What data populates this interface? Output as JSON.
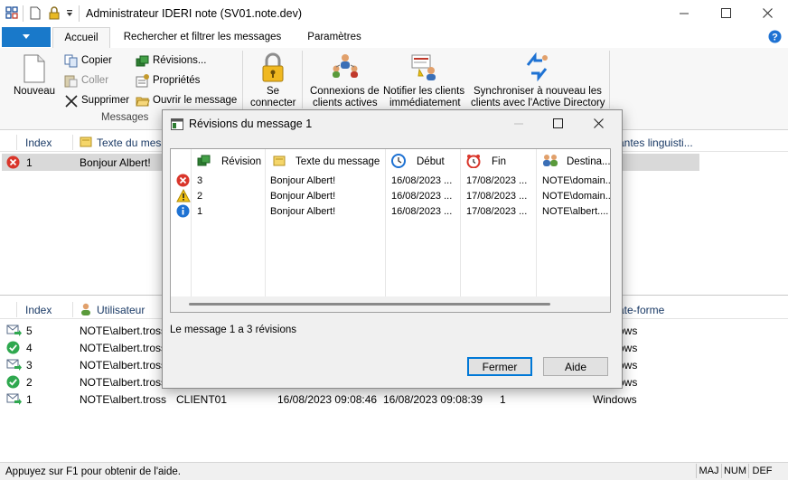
{
  "window": {
    "title": "Administrateur IDERI note (SV01.note.dev)"
  },
  "ribbon": {
    "tabs": [
      {
        "label": "Accueil",
        "active": true
      },
      {
        "label": "Rechercher et filtrer les messages",
        "active": false
      },
      {
        "label": "Paramètres",
        "active": false
      }
    ],
    "new_label": "Nouveau",
    "copy_label": "Copier",
    "paste_label": "Coller",
    "delete_label": "Supprimer",
    "revisions_label": "Révisions...",
    "properties_label": "Propriétés",
    "open_label": "Ouvrir le message",
    "group_messages": "Messages",
    "connect_line1": "Se",
    "connect_line2": "connecter",
    "client_conn_line1": "Connexions de",
    "client_conn_line2": "clients actives",
    "notify_line1": "Notifier les clients",
    "notify_line2": "immédiatement",
    "sync_line1": "Synchroniser à nouveau les",
    "sync_line2": "clients avec l'Active Directory"
  },
  "messages_list": {
    "headers": {
      "index": "Index",
      "text": "Texte du mess",
      "variants": "antes linguisti..."
    },
    "rows": [
      {
        "index": "1",
        "text": "Bonjour Albert!"
      }
    ]
  },
  "receipts_list": {
    "headers": {
      "index": "Index",
      "user": "Utilisateur",
      "platform": "ate-forme"
    },
    "rows": [
      {
        "index": "5",
        "user": "NOTE\\albert.tross",
        "client": "",
        "time1": "",
        "time2": "",
        "count": "",
        "platform": "ows",
        "icon": "envelope-arrow-icon"
      },
      {
        "index": "4",
        "user": "NOTE\\albert.tross",
        "client": "",
        "time1": "",
        "time2": "",
        "count": "",
        "platform": "ows",
        "icon": "check-circle-icon"
      },
      {
        "index": "3",
        "user": "NOTE\\albert.tross",
        "client": "",
        "time1": "",
        "time2": "",
        "count": "",
        "platform": "ows",
        "icon": "envelope-arrow-icon"
      },
      {
        "index": "2",
        "user": "NOTE\\albert.tross",
        "client": "",
        "time1": "",
        "time2": "",
        "count": "",
        "platform": "ows",
        "icon": "check-circle-icon"
      },
      {
        "index": "1",
        "user": "NOTE\\albert.tross",
        "client": "CLIENT01",
        "time1": "16/08/2023 09:08:46",
        "time2": "16/08/2023 09:08:39",
        "count": "1",
        "platform": "Windows",
        "icon": "envelope-arrow-icon"
      }
    ]
  },
  "dialog": {
    "title": "Révisions du message 1",
    "headers": {
      "revision": "Révision",
      "text": "Texte du message",
      "start": "Début",
      "end": "Fin",
      "dest": "Destina..."
    },
    "rows": [
      {
        "revision": "3",
        "text": "Bonjour Albert!",
        "start": "16/08/2023 ...",
        "end": "17/08/2023 ...",
        "dest": "NOTE\\domain...",
        "icon": "error-icon"
      },
      {
        "revision": "2",
        "text": "Bonjour Albert!",
        "start": "16/08/2023 ...",
        "end": "17/08/2023 ...",
        "dest": "NOTE\\domain...",
        "icon": "warning-icon"
      },
      {
        "revision": "1",
        "text": "Bonjour Albert!",
        "start": "16/08/2023 ...",
        "end": "17/08/2023 ...",
        "dest": "NOTE\\albert....",
        "icon": "info-icon"
      }
    ],
    "summary": "Le message 1 a 3 révisions",
    "close_label": "Fermer",
    "help_label": "Aide"
  },
  "statusbar": {
    "hint": "Appuyez sur F1 pour obtenir de l'aide.",
    "caps": "MAJ",
    "num": "NUM",
    "def": "DEF"
  },
  "colors": {
    "accent": "#1979ca",
    "error": "#d9362b",
    "warning": "#f3c416",
    "info": "#1e72d3",
    "ok": "#2fa84f"
  }
}
